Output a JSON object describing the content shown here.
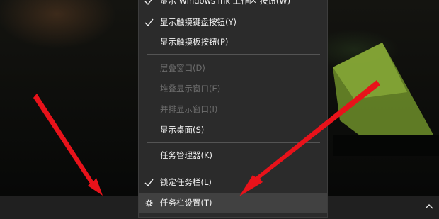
{
  "menu": {
    "items": [
      {
        "label": "显示 Windows Ink 工作区 按钮(W)",
        "checked": true,
        "disabled": false
      },
      {
        "label": "显示触摸键盘按钮(Y)",
        "checked": true,
        "disabled": false
      },
      {
        "label": "显示触摸板按钮(P)",
        "checked": false,
        "disabled": false
      },
      {
        "label": "层叠窗口(D)",
        "checked": false,
        "disabled": true
      },
      {
        "label": "堆叠显示窗口(E)",
        "checked": false,
        "disabled": true
      },
      {
        "label": "并排显示窗口(I)",
        "checked": false,
        "disabled": true
      },
      {
        "label": "显示桌面(S)",
        "checked": false,
        "disabled": false
      },
      {
        "label": "任务管理器(K)",
        "checked": false,
        "disabled": false
      },
      {
        "label": "锁定任务栏(L)",
        "checked": true,
        "disabled": false
      },
      {
        "label": "任务栏设置(T)",
        "checked": false,
        "disabled": false,
        "icon": "gear-icon",
        "highlighted": true
      }
    ]
  },
  "taskbar": {
    "tray_icon": "chevron-up-icon"
  },
  "annotations": {
    "arrow_color": "#e8121a"
  },
  "colors": {
    "menu_bg": "#2b2b2b",
    "taskbar_bg": "#202020",
    "hover_bg": "#414141"
  }
}
